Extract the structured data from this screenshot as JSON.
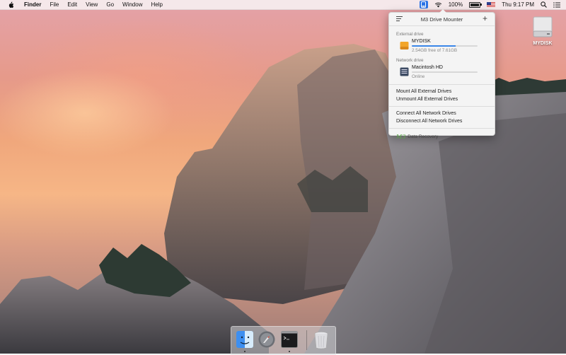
{
  "menubar": {
    "app": "Finder",
    "items": [
      "File",
      "Edit",
      "View",
      "Go",
      "Window",
      "Help"
    ],
    "battery": "100%",
    "clock": "Thu 9:17 PM"
  },
  "desktop": {
    "disk_label": "MYDISK"
  },
  "popover": {
    "title": "M3 Drive Mounter",
    "external_label": "External drive",
    "external_drive": {
      "name": "MYDISK",
      "info": "2.54GB free of 7.61GB",
      "used_fraction": 0.67
    },
    "network_label": "Network drive",
    "network_drive": {
      "name": "Macintosh HD",
      "status": "Online",
      "used_fraction": 0.0
    },
    "actions": {
      "mount_external": "Mount All External Drives",
      "unmount_external": "Unmount All External Drives",
      "connect_network": "Connect All Network Drives",
      "disconnect_network": "Disconnect All Network Drives"
    },
    "footer": {
      "logo": "M3",
      "text": "Data Recovery"
    }
  },
  "dock": {
    "items": [
      "finder-icon",
      "launchpad-icon",
      "terminal-icon",
      "trash-icon"
    ]
  },
  "colors": {
    "accent": "#3b87e8",
    "logo_green": "#5aa84a"
  }
}
